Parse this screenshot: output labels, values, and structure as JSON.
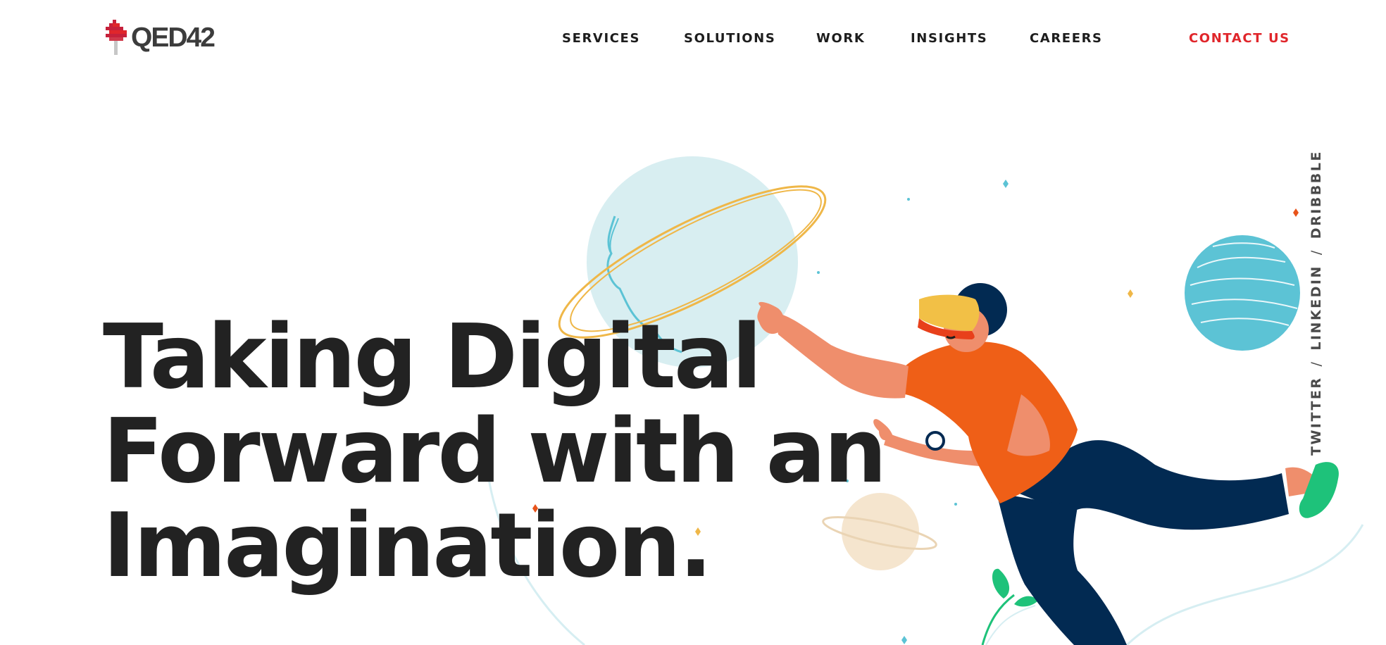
{
  "brand": {
    "name": "QED42"
  },
  "nav": {
    "items": [
      "SERVICES",
      "SOLUTIONS",
      "WORK",
      "INSIGHTS",
      "CAREERS"
    ],
    "contact": "CONTACT US"
  },
  "hero": {
    "line1": "Taking Digital",
    "line2": "Forward with an",
    "line3": "Imagination."
  },
  "social": {
    "twitter": "TWITTER",
    "linkedin": "LINKEDIN",
    "dribbble": "DRIBBBLE",
    "separator": "/"
  },
  "colors": {
    "accent": "#e0262b",
    "text": "#222222",
    "shirt": "#ef5f17",
    "pants": "#022a52",
    "skin": "#ef8e6c",
    "planet_light": "#d8eef1",
    "planet_blue": "#5cc3d5",
    "planet_beige": "#f5e5ce",
    "shoe": "#1ec27a"
  },
  "icons": [
    "qed42-logo-icon"
  ]
}
